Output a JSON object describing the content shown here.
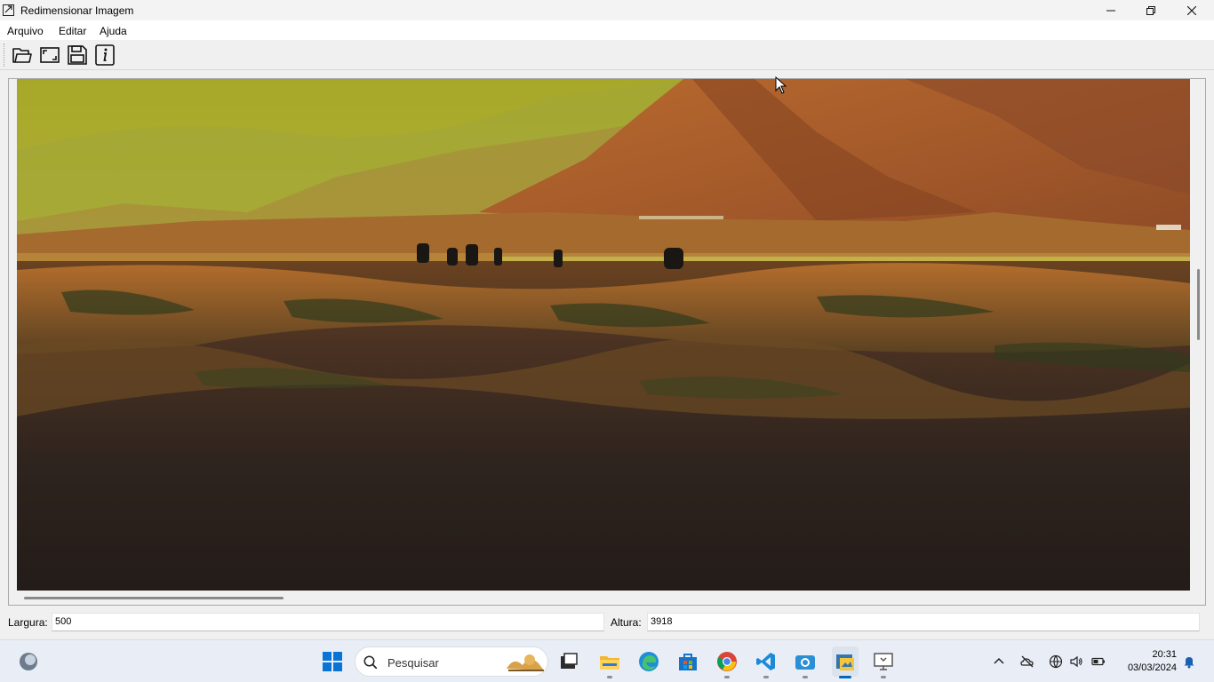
{
  "window": {
    "title": "Redimensionar Imagem",
    "icon": "resize-image-icon",
    "controls": [
      "minimize-icon",
      "restore-icon",
      "close-icon"
    ]
  },
  "menu": {
    "items": [
      {
        "label": "Arquivo"
      },
      {
        "label": "Editar"
      },
      {
        "label": "Ajuda"
      }
    ]
  },
  "toolbar": {
    "buttons": [
      {
        "icon": "open-folder-icon"
      },
      {
        "icon": "resize-icon"
      },
      {
        "icon": "save-icon"
      },
      {
        "icon": "info-icon"
      }
    ]
  },
  "canvas": {
    "image": "landscape-photo",
    "horizontal_scroll_position": 0,
    "vertical_scroll_position": 0.25
  },
  "fields": {
    "width_label": "Largura:",
    "width_value": "500",
    "height_label": "Altura:",
    "height_value": "3918"
  },
  "taskbar": {
    "search_placeholder": "Pesquisar",
    "apps": [
      "widgets-icon",
      "start-icon",
      "search-icon",
      "task-view-icon",
      "file-explorer-icon",
      "edge-icon",
      "store-icon",
      "chrome-icon",
      "vscode-icon",
      "camera-app-icon",
      "image-resizer-app-icon",
      "remote-desktop-icon"
    ],
    "tray": [
      "chevron-up-icon",
      "onedrive-off-icon",
      "network-icon",
      "volume-icon",
      "battery-icon",
      "notification-bell-icon"
    ],
    "time": "20:31",
    "date": "03/03/2024"
  },
  "colors": {
    "accent": "#0067c0",
    "window_bg": "#f0f0f0"
  }
}
